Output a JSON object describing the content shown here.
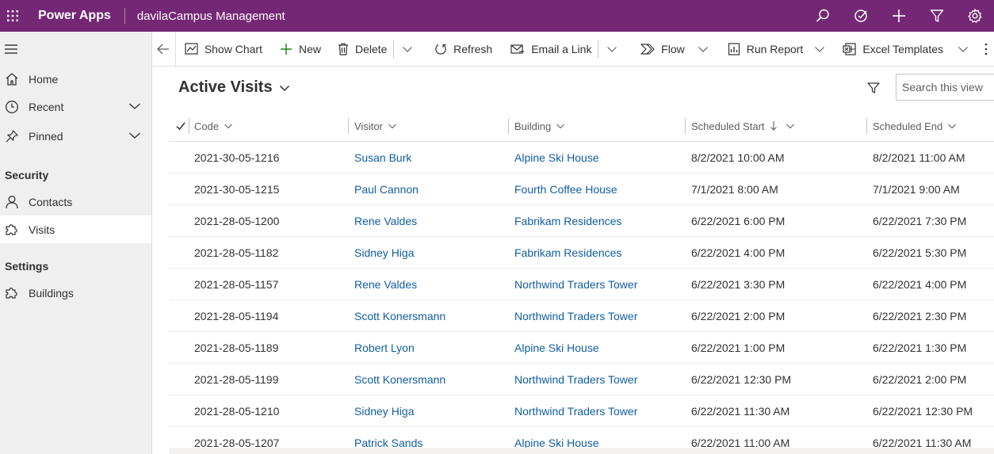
{
  "topbar": {
    "brand": "Power Apps",
    "app_name": "davilaCampus Management",
    "icons": [
      "search-icon",
      "lightbulb-icon",
      "plus-icon",
      "filter-icon",
      "gear-icon"
    ],
    "color": "#742774"
  },
  "sidebar": {
    "items_top": [
      {
        "label": "Home",
        "icon": "home-icon"
      },
      {
        "label": "Recent",
        "icon": "clock-icon",
        "expandable": true
      },
      {
        "label": "Pinned",
        "icon": "pin-icon",
        "expandable": true
      }
    ],
    "section_security": "Security",
    "security_items": [
      {
        "label": "Contacts",
        "icon": "person-icon"
      },
      {
        "label": "Visits",
        "icon": "puzzle-icon",
        "active": true
      }
    ],
    "section_settings": "Settings",
    "settings_items": [
      {
        "label": "Buildings",
        "icon": "puzzle-icon"
      }
    ]
  },
  "commandbar": {
    "show_chart": "Show Chart",
    "new": "New",
    "delete": "Delete",
    "refresh": "Refresh",
    "email_link": "Email a Link",
    "flow": "Flow",
    "run_report": "Run Report",
    "excel_templates": "Excel Templates"
  },
  "view": {
    "title": "Active Visits",
    "search_placeholder": "Search this view"
  },
  "grid": {
    "columns": [
      "Code",
      "Visitor",
      "Building",
      "Scheduled Start",
      "Scheduled End"
    ],
    "sorted_column": "Scheduled Start",
    "sort_direction": "descending",
    "rows": [
      {
        "code": "2021-30-05-1216",
        "visitor": "Susan Burk",
        "building": "Alpine Ski House",
        "start": "8/2/2021 10:00 AM",
        "end": "8/2/2021 11:00 AM"
      },
      {
        "code": "2021-30-05-1215",
        "visitor": "Paul Cannon",
        "building": "Fourth Coffee House",
        "start": "7/1/2021 8:00 AM",
        "end": "7/1/2021 9:00 AM"
      },
      {
        "code": "2021-28-05-1200",
        "visitor": "Rene Valdes",
        "building": "Fabrikam Residences",
        "start": "6/22/2021 6:00 PM",
        "end": "6/22/2021 7:30 PM"
      },
      {
        "code": "2021-28-05-1182",
        "visitor": "Sidney Higa",
        "building": "Fabrikam Residences",
        "start": "6/22/2021 4:00 PM",
        "end": "6/22/2021 5:30 PM"
      },
      {
        "code": "2021-28-05-1157",
        "visitor": "Rene Valdes",
        "building": "Northwind Traders Tower",
        "start": "6/22/2021 3:30 PM",
        "end": "6/22/2021 4:00 PM"
      },
      {
        "code": "2021-28-05-1194",
        "visitor": "Scott Konersmann",
        "building": "Northwind Traders Tower",
        "start": "6/22/2021 2:00 PM",
        "end": "6/22/2021 2:30 PM"
      },
      {
        "code": "2021-28-05-1189",
        "visitor": "Robert Lyon",
        "building": "Alpine Ski House",
        "start": "6/22/2021 1:00 PM",
        "end": "6/22/2021 1:30 PM"
      },
      {
        "code": "2021-28-05-1199",
        "visitor": "Scott Konersmann",
        "building": "Northwind Traders Tower",
        "start": "6/22/2021 12:30 PM",
        "end": "6/22/2021 2:00 PM"
      },
      {
        "code": "2021-28-05-1210",
        "visitor": "Sidney Higa",
        "building": "Northwind Traders Tower",
        "start": "6/22/2021 11:30 AM",
        "end": "6/22/2021 12:30 PM"
      },
      {
        "code": "2021-28-05-1207",
        "visitor": "Patrick Sands",
        "building": "Alpine Ski House",
        "start": "6/22/2021 11:00 AM",
        "end": "6/22/2021 11:30 AM"
      }
    ]
  },
  "colors": {
    "link": "#115ea3",
    "text": "#323130",
    "sidebar_bg": "#efefef"
  }
}
